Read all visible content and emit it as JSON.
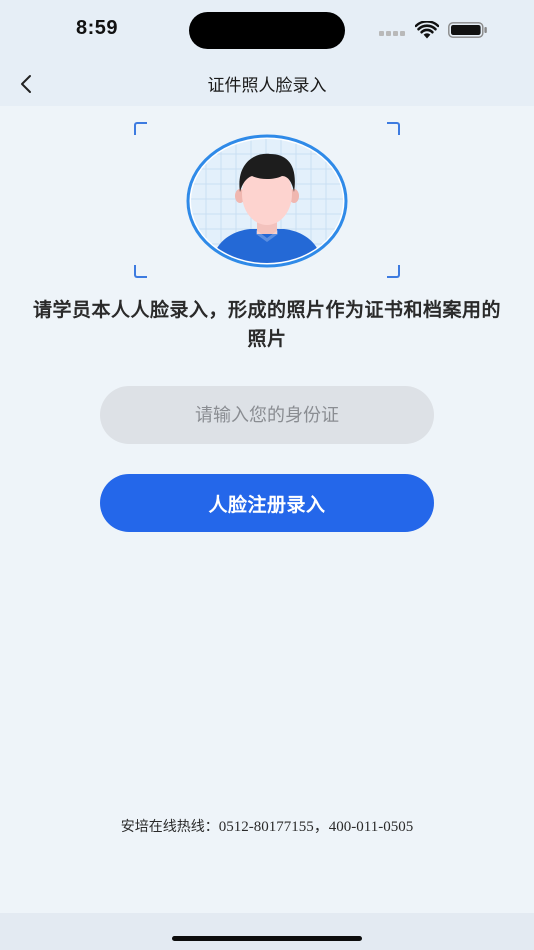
{
  "status_bar": {
    "time": "8:59"
  },
  "nav": {
    "title": "证件照人脸录入",
    "back_icon": "chevron-left-icon"
  },
  "instruction": "请学员本人人脸录入，形成的照片作为证书和档案用的照片",
  "id_input": {
    "placeholder": "请输入您的身份证",
    "value": ""
  },
  "register_button": {
    "label": "人脸注册录入"
  },
  "hotline": {
    "label": "安培在线热线：",
    "numbers": "0512-80177155，400-011-0505"
  },
  "colors": {
    "accent": "#2467ea",
    "frame_corner": "#3d7be0",
    "avatar_ring": "#2f8ae8",
    "background": "#eef4f9",
    "input_bg": "#dde1e6"
  }
}
